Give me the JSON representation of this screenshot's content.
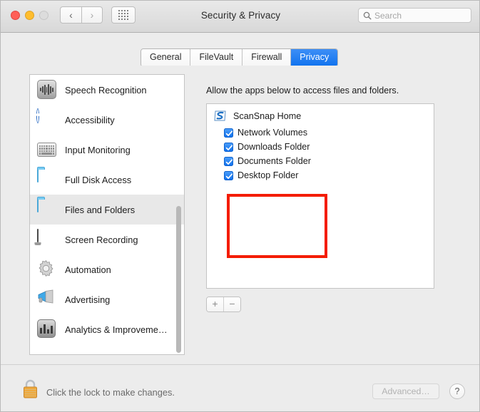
{
  "window": {
    "title": "Security & Privacy",
    "traffic_lights": [
      "close",
      "minimize",
      "zoom"
    ],
    "nav": {
      "back": "‹",
      "forward": "›",
      "grid": "grid-view"
    }
  },
  "search": {
    "placeholder": "Search",
    "value": "",
    "icon": "search-icon"
  },
  "tabs": [
    {
      "label": "General",
      "active": false
    },
    {
      "label": "FileVault",
      "active": false
    },
    {
      "label": "Firewall",
      "active": false
    },
    {
      "label": "Privacy",
      "active": true
    }
  ],
  "sidebar": {
    "items": [
      {
        "label": "Speech Recognition",
        "icon": "speech-recognition-icon",
        "selected": false
      },
      {
        "label": "Accessibility",
        "icon": "accessibility-icon",
        "selected": false
      },
      {
        "label": "Input Monitoring",
        "icon": "keyboard-icon",
        "selected": false
      },
      {
        "label": "Full Disk Access",
        "icon": "folder-icon",
        "selected": false
      },
      {
        "label": "Files and Folders",
        "icon": "folder-icon",
        "selected": true
      },
      {
        "label": "Screen Recording",
        "icon": "display-icon",
        "selected": false
      },
      {
        "label": "Automation",
        "icon": "gear-icon",
        "selected": false
      },
      {
        "label": "Advertising",
        "icon": "megaphone-icon",
        "selected": false
      },
      {
        "label": "Analytics & Improveme…",
        "icon": "bar-chart-icon",
        "selected": false
      }
    ]
  },
  "main": {
    "caption": "Allow the apps below to access files and folders.",
    "apps": [
      {
        "name": "ScanSnap Home",
        "icon": "scansnap-icon",
        "permissions": [
          {
            "label": "Network Volumes",
            "checked": true
          },
          {
            "label": "Downloads Folder",
            "checked": true
          },
          {
            "label": "Documents Folder",
            "checked": true
          },
          {
            "label": "Desktop Folder",
            "checked": true
          }
        ]
      }
    ],
    "add_button": "+",
    "remove_button": "−",
    "annotation": {
      "type": "highlight-box",
      "color": "#f41c00"
    }
  },
  "footer": {
    "lock_icon": "lock-closed-icon",
    "lock_text": "Click the lock to make changes.",
    "advanced_label": "Advanced…",
    "advanced_disabled": true,
    "help_label": "?"
  },
  "colors": {
    "accent": "#1072ee",
    "annotation": "#f41c00",
    "window_bg": "#ececec",
    "panel_bg": "#ffffff"
  }
}
